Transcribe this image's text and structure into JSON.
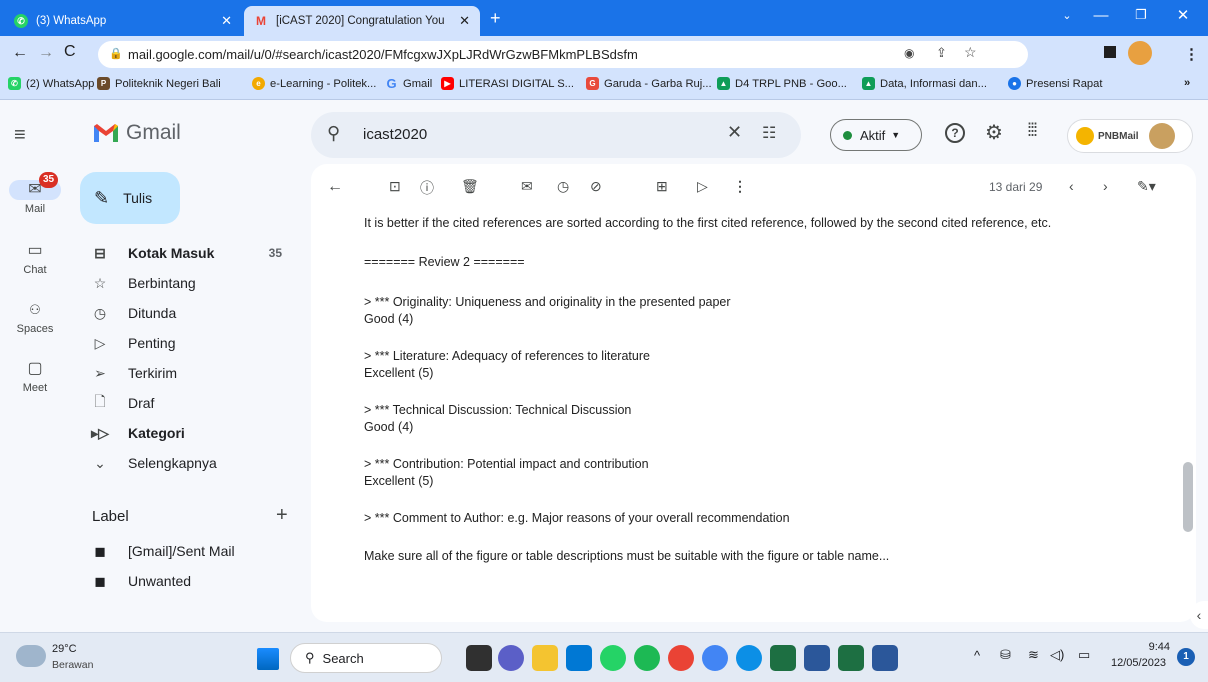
{
  "browser": {
    "tabs": [
      {
        "label": "(3) WhatsApp",
        "active": false
      },
      {
        "label": "[iCAST 2020] Congratulation You",
        "active": true
      }
    ],
    "new_tab": "+",
    "url": "mail.google.com/mail/u/0/#search/icast2020/FMfcgxwJXpLJRdWrGzwBFMkmPLBSdsfm",
    "bookmarks": [
      "(2) WhatsApp",
      "Politeknik Negeri Bali",
      "e-Learning - Politek...",
      "Gmail",
      "LITERASI DIGITAL S...",
      "Garuda - Garba Ruj...",
      "D4 TRPL PNB - Goo...",
      "Data, Informasi dan...",
      "Presensi Rapat"
    ],
    "bookmarks_more": "»"
  },
  "gmail": {
    "logo_text": "Gmail",
    "search_value": "icast2020",
    "status": "Aktif",
    "org_logo": "PNBMail",
    "compose": "Tulis",
    "rail": [
      {
        "label": "Mail",
        "badge": "35"
      },
      {
        "label": "Chat"
      },
      {
        "label": "Spaces"
      },
      {
        "label": "Meet"
      }
    ],
    "nav": [
      {
        "label": "Kotak Masuk",
        "count": "35",
        "bold": true
      },
      {
        "label": "Berbintang"
      },
      {
        "label": "Ditunda"
      },
      {
        "label": "Penting"
      },
      {
        "label": "Terkirim"
      },
      {
        "label": "Draf"
      },
      {
        "label": "Kategori",
        "bold": true
      },
      {
        "label": "Selengkapnya"
      }
    ],
    "label_header": "Label",
    "labels": [
      "[Gmail]/Sent Mail",
      "Unwanted"
    ],
    "pagination": "13 dari 29"
  },
  "email_lines": [
    "It is better if the cited references are sorted according to the first cited reference, followed by the second cited reference, etc.",
    "======= Review 2 =======",
    "> *** Originality: Uniqueness and originality in the presented paper",
    "Good (4)",
    "> *** Literature: Adequacy of references to literature",
    "Excellent (5)",
    "> *** Technical Discussion: Technical Discussion",
    "Good (4)",
    "> *** Contribution: Potential impact and contribution",
    "Excellent (5)",
    "> *** Comment to Author: e.g. Major reasons of your overall recommendation",
    "Make sure all of the figure or table descriptions must be suitable with the figure or table name..."
  ],
  "taskbar": {
    "weather_temp": "29°C",
    "weather_desc": "Berawan",
    "search_label": "Search",
    "time": "9:44",
    "date": "12/05/2023",
    "notif": "1"
  },
  "colors": {
    "chrome_blue": "#1a73e8",
    "gmail_red": "#ea4335",
    "compose": "#c2e7ff"
  }
}
